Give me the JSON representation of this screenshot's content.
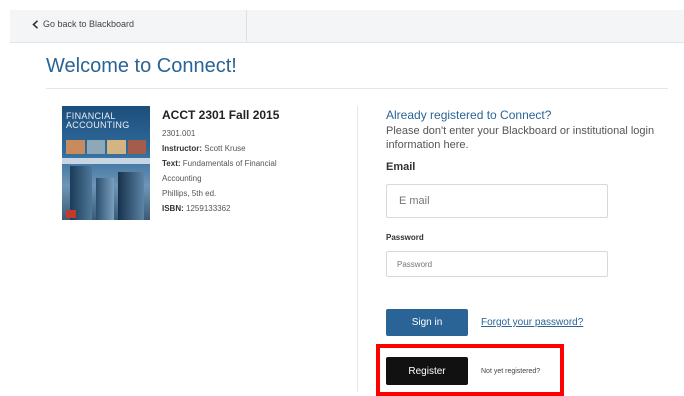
{
  "topbar": {
    "back_label": "Go back to Blackboard"
  },
  "page": {
    "title": "Welcome to Connect!"
  },
  "book": {
    "cover_title_line1": "FINANCIAL",
    "cover_title_line2": "ACCOUNTING"
  },
  "course": {
    "title": "ACCT 2301 Fall 2015",
    "section": "2301.001",
    "instructor_label": "Instructor:",
    "instructor_value": "Scott Kruse",
    "text_label": "Text:",
    "text_value_line1": "Fundamentals of Financial",
    "text_value_line2": "Accounting",
    "edition": "Phillips, 5th ed.",
    "isbn_label": "ISBN:",
    "isbn_value": "1259133362"
  },
  "login": {
    "heading": "Already registered to Connect?",
    "note": "Please don't enter your Blackboard or institutional login information here.",
    "email_label": "Email",
    "email_placeholder": "E mail",
    "password_label": "Password",
    "password_placeholder": "Password",
    "signin_label": "Sign in",
    "forgot_label": "Forgot your password?",
    "register_label": "Register",
    "not_registered_label": "Not yet registered?"
  },
  "colors": {
    "accent": "#2a6496",
    "highlight": "#ff0000",
    "register_bg": "#111111"
  },
  "icons": {
    "back": "chevron-left-icon"
  }
}
